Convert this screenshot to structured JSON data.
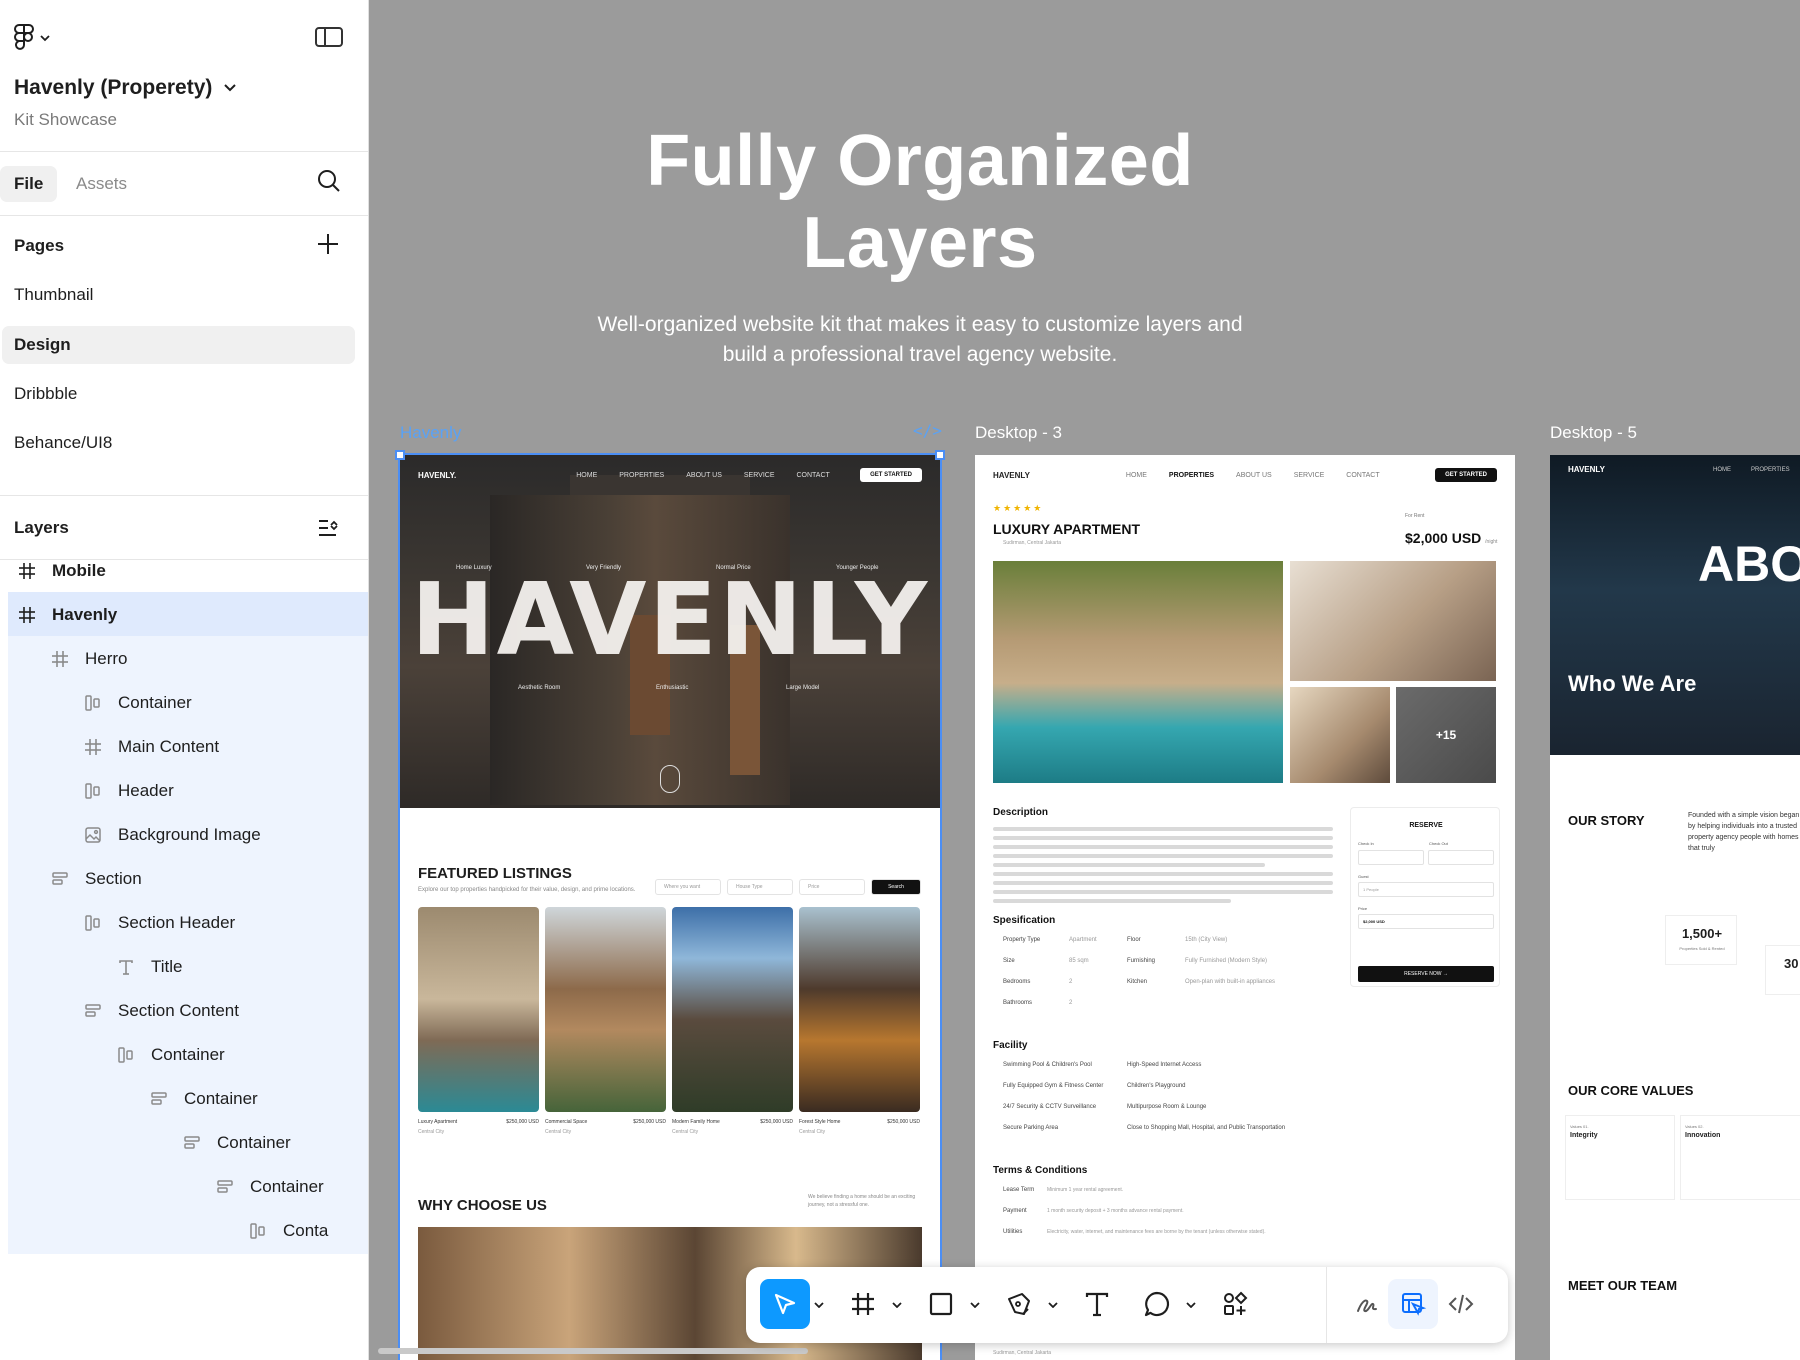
{
  "app": {
    "file_name": "Havenly (Properety)",
    "file_subtitle": "Kit Showcase"
  },
  "sidebar": {
    "tabs": [
      {
        "label": "File",
        "active": true
      },
      {
        "label": "Assets",
        "active": false
      }
    ],
    "pages_header": "Pages",
    "pages": [
      {
        "label": "Thumbnail",
        "selected": false
      },
      {
        "label": "Design",
        "selected": true
      },
      {
        "label": "Dribbble",
        "selected": false
      },
      {
        "label": "Behance/UI8",
        "selected": false
      }
    ],
    "layers_header": "Layers",
    "layers": [
      {
        "label": "Mobile",
        "icon": "frame-icon",
        "depth": 0
      },
      {
        "label": "Havenly",
        "icon": "frame-icon",
        "depth": 0
      },
      {
        "label": "Herro",
        "icon": "frame-icon",
        "depth": 1
      },
      {
        "label": "Container",
        "icon": "auto-layout-horizontal-icon",
        "depth": 2
      },
      {
        "label": "Main Content",
        "icon": "frame-icon",
        "depth": 2
      },
      {
        "label": "Header",
        "icon": "auto-layout-horizontal-icon",
        "depth": 2
      },
      {
        "label": "Background Image",
        "icon": "image-icon",
        "depth": 2
      },
      {
        "label": "Section",
        "icon": "auto-layout-vertical-icon",
        "depth": 1
      },
      {
        "label": "Section Header",
        "icon": "auto-layout-horizontal-icon",
        "depth": 2
      },
      {
        "label": "Title",
        "icon": "text-icon",
        "depth": 3
      },
      {
        "label": "Section Content",
        "icon": "auto-layout-vertical-icon",
        "depth": 2
      },
      {
        "label": "Container",
        "icon": "auto-layout-horizontal-icon",
        "depth": 3
      },
      {
        "label": "Container",
        "icon": "auto-layout-vertical-icon",
        "depth": 4
      },
      {
        "label": "Container",
        "icon": "auto-layout-vertical-icon",
        "depth": 5
      },
      {
        "label": "Container",
        "icon": "auto-layout-vertical-icon",
        "depth": 6
      },
      {
        "label": "Conta",
        "icon": "auto-layout-horizontal-icon",
        "depth": 7
      }
    ]
  },
  "canvas": {
    "hero_title_line1": "Fully Organized",
    "hero_title_line2": "Layers",
    "hero_sub_line1": "Well-organized website kit that makes it easy to customize layers and",
    "hero_sub_line2": "build a professional travel agency website.",
    "frames": [
      {
        "label": "Havenly",
        "selected": true
      },
      {
        "label": "Desktop - 3",
        "selected": false
      },
      {
        "label": "Desktop - 5",
        "selected": false
      }
    ],
    "code_glyph": "</>"
  },
  "frame_havenly": {
    "brand": "HAVENLY.",
    "nav": [
      "HOME",
      "PROPERTIES",
      "ABOUT US",
      "SERVICE",
      "CONTACT"
    ],
    "cta": "GET STARTED",
    "hero_word": "HAVENLY",
    "tags": [
      "Home Luxury",
      "Very Friendly",
      "Normal Price",
      "Younger People",
      "Aesthetic Room",
      "Enthusiastic",
      "Large Model"
    ],
    "featured_title": "FEATURED LISTINGS",
    "featured_sub": "Explore our top properties handpicked for their value, design, and prime locations.",
    "filters": [
      "Where you want",
      "House Type",
      "Price"
    ],
    "search_btn": "Search",
    "listings": [
      {
        "name": "Luxury Apartment",
        "price": "$250,000 USD",
        "loc": "Central City"
      },
      {
        "name": "Commercial Space",
        "price": "$250,000 USD",
        "loc": "Central City"
      },
      {
        "name": "Modern Family Home",
        "price": "$250,000 USD",
        "loc": "Central City"
      },
      {
        "name": "Forest Style Home",
        "price": "$250,000 USD",
        "loc": "Central City"
      }
    ],
    "why_title": "WHY CHOOSE US",
    "why_note": "We believe finding a home should be an exciting journey, not a stressful one."
  },
  "frame_desktop3": {
    "brand": "HAVENLY",
    "nav": [
      "HOME",
      "PROPERTIES",
      "ABOUT US",
      "SERVICE",
      "CONTACT"
    ],
    "cta": "GET STARTED",
    "stars": "★★★★★",
    "title": "LUXURY APARTMENT",
    "location": "Sudirman, Central Jakarta",
    "for_rent": "For Rent",
    "price": "$2,000 USD",
    "price_unit": "/night",
    "more_photos": "+15",
    "description_h": "Description",
    "reserve_h": "RESERVE",
    "reserve_btn": "RESERVE NOW →",
    "check_in": "Check In",
    "check_out": "Check Out",
    "guest": "Guest",
    "guest_value": "1 People",
    "price_label": "Price",
    "price_value": "$2,000 USD",
    "spec_h": "Spesification",
    "specs": [
      {
        "k": "Property Type",
        "v": "Apartment"
      },
      {
        "k": "Floor",
        "v": "15th (City View)"
      },
      {
        "k": "Size",
        "v": "85 sqm"
      },
      {
        "k": "Furnishing",
        "v": "Fully Furnished (Modern Style)"
      },
      {
        "k": "Bedrooms",
        "v": "2"
      },
      {
        "k": "Kitchen",
        "v": "Open-plan with built-in appliances"
      },
      {
        "k": "Bathrooms",
        "v": "2"
      }
    ],
    "facility_h": "Facility",
    "facilities": [
      "Swimming Pool & Children's Pool",
      "High-Speed Internet Access",
      "Fully Equipped Gym & Fitness Center",
      "Children's Playground",
      "24/7 Security & CCTV Surveillance",
      "Multipurpose Room & Lounge",
      "Secure Parking Area",
      "Close to Shopping Mall, Hospital, and Public Transportation"
    ],
    "terms_h": "Terms & Conditions",
    "terms": [
      {
        "k": "Lease Term",
        "v": "Minimum 1 year rental agreement."
      },
      {
        "k": "Payment",
        "v": "1 month security deposit + 3 months advance rental payment."
      },
      {
        "k": "Utilities",
        "v": "Electricity, water, internet, and maintenance fees are borne by the tenant (unless otherwise stated)."
      }
    ],
    "footer_loc": "Sudirman, Central Jakarta"
  },
  "frame_desktop5": {
    "brand": "HAVENLY",
    "nav": [
      "HOME",
      "PROPERTIES"
    ],
    "hero_word": "ABO",
    "who": "Who We Are",
    "our_story": "OUR STORY",
    "story_text": "Founded with a simple vision began by helping individuals into a trusted property agency people with homes that truly",
    "stat_value": "1,500+",
    "stat_label": "Properties Sold & Rented",
    "stat2_value": "30",
    "core_values": "OUR CORE VALUES",
    "values": [
      {
        "num": "Values 01.",
        "name": "Integrity"
      },
      {
        "num": "Values 02.",
        "name": "Innovation"
      }
    ],
    "team": "MEET OUR TEAM"
  },
  "toolbar": {
    "tools": [
      "move-tool",
      "frame-tool",
      "rectangle-tool",
      "pen-tool",
      "text-tool",
      "comment-tool",
      "actions-tool"
    ],
    "right_tools": [
      "draw-mode",
      "design-mode",
      "dev-mode"
    ],
    "accent": "#0d99ff"
  },
  "colors": {
    "canvas_bg": "#9b9b9b",
    "selection": "#4b8ef5",
    "layer_highlight": "#eef4fe"
  }
}
